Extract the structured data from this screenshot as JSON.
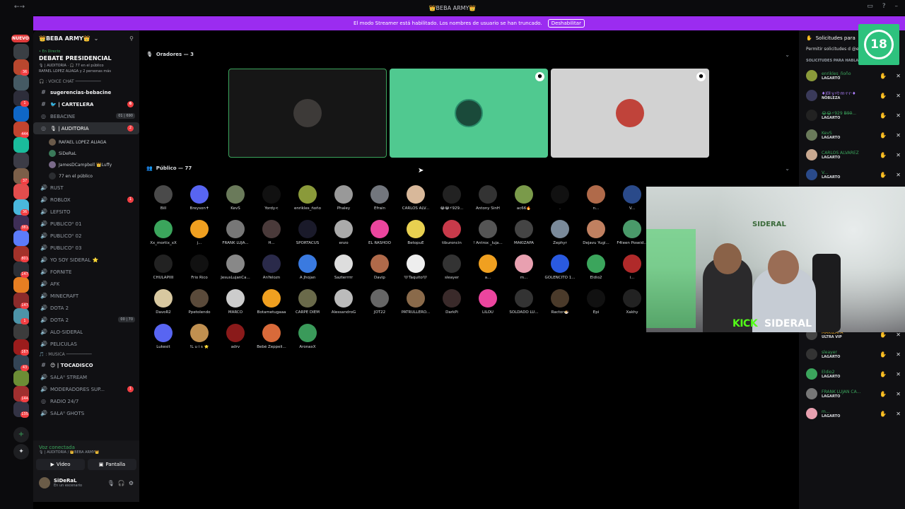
{
  "window": {
    "title": "👑BEBA ARMY👑",
    "nav_label": "←→"
  },
  "banner": {
    "text": "El modo Streamer está habilitado. Los nombres de usuario se han truncado.",
    "button": "Deshabilitar"
  },
  "rail": {
    "new_label": "NUEVO",
    "badges": [
      "36",
      "1",
      "444",
      "37",
      "36",
      "381",
      "801",
      "147",
      "147",
      "1",
      "167",
      "43",
      "144",
      "135"
    ],
    "colors": [
      "#3a3f44",
      "#b8472e",
      "#455a64",
      "#2d2d3a",
      "#0f67c7",
      "#c1442f",
      "#1abc9c",
      "#3c3c46",
      "#7b5f49",
      "#e24d4d",
      "#4ab7dc",
      "#3e2e56",
      "#5c7cfa",
      "#a3322a",
      "#2b2f36",
      "#e67e22",
      "#8b2b2b",
      "#4d94a8",
      "#3c3c3c",
      "#9b1c1c",
      "#345",
      "#6c8d35",
      "#a02f2f",
      "#334"
    ]
  },
  "channels": {
    "server_name": "👑BEBA ARMY👑",
    "live_tag": "• En Directo",
    "event_title": "DEBATE PRESIDENCIAL",
    "event_line1": "🎙 | AUDITORIA · 🎧 77 en el público",
    "event_line2": "RAFAEL LOPEZ ALIAGA y 2 personas más",
    "cat_voice": "🎧 : VOICE CHAT ──────────",
    "items": [
      {
        "label": "sugerencias-bebacine",
        "icon": "#",
        "bold": true
      },
      {
        "label": "🐦 | CARTELERA",
        "icon": "#",
        "bold": true,
        "badge": "6"
      },
      {
        "label": "BEBACINE",
        "icon": "◎",
        "counts": "01 | 690"
      },
      {
        "label": "🎙 | AUDITORIA",
        "icon": "◎",
        "selected": true,
        "badge": "2"
      }
    ],
    "auditoria_sub": "DEBATE PRESIDENCIAL",
    "members": [
      "RAFAEL LOPEZ ALIAGA",
      "SiDeRaL",
      "JamesDCampbell 👑Luffy",
      "77 en el público"
    ],
    "items2": [
      {
        "label": "RUST",
        "icon": "🔊"
      },
      {
        "label": "ROBLOX",
        "icon": "🔊",
        "badge": "1"
      },
      {
        "label": "LEFSITO",
        "icon": "🔊"
      },
      {
        "label": "PUBLICO⁰ 01",
        "icon": "🔊"
      },
      {
        "label": "PUBLICO⁰ 02",
        "icon": "🔊"
      },
      {
        "label": "PUBLICO⁰ 03",
        "icon": "🔊"
      },
      {
        "label": "YO SOY SIDERAL ⭐",
        "icon": "🔊"
      },
      {
        "label": "FORNITE",
        "icon": "🔊"
      },
      {
        "label": "AFK",
        "icon": "🔊"
      },
      {
        "label": "MINECRAFT",
        "icon": "🔊"
      },
      {
        "label": "DOTA 2",
        "icon": "🔊"
      },
      {
        "label": "DOTA 2",
        "icon": "🔊",
        "counts": "00 | 70"
      },
      {
        "label": "ALO-SIDERAL",
        "icon": "🔊"
      },
      {
        "label": "PELICULAS",
        "icon": "🔊"
      }
    ],
    "cat_music": "🎵 : MUSICA ──────────",
    "items3": [
      {
        "label": "😊 | TOCADISCO",
        "icon": "#",
        "bold": true
      },
      {
        "label": "SALA⁰ STREAM",
        "icon": "🔊"
      },
      {
        "label": "MODERADORES SUP...",
        "icon": "🔊",
        "badge": "1"
      },
      {
        "label": "RADIO 24/7",
        "icon": "◎"
      },
      {
        "label": "SALA⁰ GHOTS",
        "icon": "🔊"
      }
    ]
  },
  "voice": {
    "status": "Voz conectada",
    "sub": "🎙 | AUDITORIA / 👑BEBA ARMY👑",
    "video": "Video",
    "screen": "Pantalla"
  },
  "user": {
    "name": "SiDeRaL",
    "status": "En un escenario"
  },
  "stage": {
    "speakers_header": "Oradores — 3",
    "audience_header": "Público — 77",
    "audience": [
      {
        "name": "Bill",
        "color": "#4a4a4a"
      },
      {
        "name": "Breyson✝",
        "color": "#5865f2"
      },
      {
        "name": "KevS",
        "color": "#6a7a5a"
      },
      {
        "name": "Yordy<",
        "color": "#111"
      },
      {
        "name": "enrikles_ñoño",
        "color": "#8a9a3a"
      },
      {
        "name": "Phaley",
        "color": "#999"
      },
      {
        "name": "Efrain",
        "color": "#72767d"
      },
      {
        "name": "CARLOS ALV...",
        "color": "#d8b89a"
      },
      {
        "name": "😂😂⚡929...",
        "color": "#222"
      },
      {
        "name": "Antony SinH",
        "color": "#333"
      },
      {
        "name": "ac66🔥",
        "color": "#7a9a4a"
      },
      {
        "name": ".",
        "color": "#111"
      },
      {
        "name": "n...",
        "color": "#b06a4a"
      },
      {
        "name": "V...",
        "color": "#2a4a8a"
      },
      {
        "name": "Xx_mortix_xX",
        "color": "#3ba55c"
      },
      {
        "name": "j...",
        "color": "#f0a020"
      },
      {
        "name": "FRANK LUJA...",
        "color": "#777"
      },
      {
        "name": "H...",
        "color": "#4a3a3a"
      },
      {
        "name": "SPORTACUS",
        "color": "#1a1a2a"
      },
      {
        "name": "enzo",
        "color": "#aaa"
      },
      {
        "name": "EL RASHOO",
        "color": "#eb459e"
      },
      {
        "name": "BetopuE",
        "color": "#e8d050"
      },
      {
        "name": "tiburoncin",
        "color": "#c83a4a"
      },
      {
        "name": "! Antrox _luja...",
        "color": "#555"
      },
      {
        "name": "MAKIZAPA",
        "color": "#444"
      },
      {
        "name": "Zephyr",
        "color": "#7a8a9a"
      },
      {
        "name": "Dejavu Yugi...",
        "color": "#c08060"
      },
      {
        "name": "F4leen Poseid...",
        "color": "#4a9a6a"
      },
      {
        "name": "CHULAPIIII",
        "color": "#222"
      },
      {
        "name": "Frio Rico",
        "color": "#111"
      },
      {
        "name": "JesusLujanCa...",
        "color": "#888"
      },
      {
        "name": "AnYelozn",
        "color": "#2a2a4a"
      },
      {
        "name": "A Jhojan",
        "color": "#3a7ae0"
      },
      {
        "name": "Sazterrrrr",
        "color": "#ddd"
      },
      {
        "name": "Davip",
        "color": "#b06a4a"
      },
      {
        "name": "🖤Taquito🖤",
        "color": "#eee"
      },
      {
        "name": "sleayer",
        "color": "#333"
      },
      {
        "name": "a...",
        "color": "#f0a020"
      },
      {
        "name": "m...",
        "color": "#e8a0b0"
      },
      {
        "name": "GOLENCITO 1...",
        "color": "#2a5ae0"
      },
      {
        "name": "Eldio2",
        "color": "#3ba55c"
      },
      {
        "name": "i...",
        "color": "#b02a2a"
      },
      {
        "name": "DavoR2",
        "color": "#d8c8a0"
      },
      {
        "name": "Ppetolendo",
        "color": "#5a4a3a"
      },
      {
        "name": "MARCO",
        "color": "#ccc"
      },
      {
        "name": "Botametugaaa",
        "color": "#f0a020"
      },
      {
        "name": "CARPE DIEM",
        "color": "#6a6a4a"
      },
      {
        "name": "AlessandroG",
        "color": "#bbb"
      },
      {
        "name": "JOT22",
        "color": "#666"
      },
      {
        "name": "PATRULLERO...",
        "color": "#8a6a4a"
      },
      {
        "name": "DarkPi",
        "color": "#3a2a2a"
      },
      {
        "name": "LILOU",
        "color": "#eb459e"
      },
      {
        "name": "SOLDADO LU...",
        "color": "#333"
      },
      {
        "name": "Ractor🍜",
        "color": "#4a3a2a"
      },
      {
        "name": "Epi",
        "color": "#111"
      },
      {
        "name": "Xakhy",
        "color": "#222"
      },
      {
        "name": "Lukesit",
        "color": "#5865f2"
      },
      {
        "name": "!L u i s ⭐",
        "color": "#c09050"
      },
      {
        "name": "adrv",
        "color": "#8a1a1a"
      },
      {
        "name": "Bebé Zeppeli...",
        "color": "#d86a3a"
      },
      {
        "name": "AronaxX",
        "color": "#3a9a5a"
      }
    ]
  },
  "requests": {
    "title": "Solicitudes para",
    "perm": "Permitir solicitudes d @everyone",
    "label": "SOLICITUDES PARA HABLAR: 19",
    "items": [
      {
        "name": "enrikles_ñoño",
        "role": "LAGARTO",
        "color": "#3ba55c"
      },
      {
        "name": "♦J0l·y⚡t·m·r·r·♦",
        "role": "NOBLEZA",
        "color": "#b080ff"
      },
      {
        "name": "😂😂⚡929 B̶9̶0̶...",
        "role": "LAGARTO",
        "color": "#3ba55c"
      },
      {
        "name": "KevS",
        "role": "LAGARTO",
        "color": "#3ba55c"
      },
      {
        "name": "CARLOS ALVAREZ",
        "role": "LAGARTO",
        "color": "#3ba55c"
      },
      {
        "name": "V...",
        "role": "LAGARTO",
        "color": "#3ba55c"
      },
      {
        "name": "n...",
        "role": "LAGARTO",
        "color": "#3ba55c"
      },
      {
        "name": "MAKIZAPA",
        "role": "ULTRA VIP",
        "color": "#e0a020"
      },
      {
        "name": "sleayer",
        "role": "LAGARTO",
        "color": "#3ba55c"
      },
      {
        "name": "Eldio2",
        "role": "LAGARTO",
        "color": "#3ba55c"
      },
      {
        "name": "FRANK LUJAN CA...",
        "role": "LAGARTO",
        "color": "#3ba55c"
      },
      {
        "name": "m...",
        "role": "LAGARTO",
        "color": "#3ba55c"
      }
    ]
  },
  "overlay": {
    "age": "18",
    "wall_text": "SIDERAL",
    "kick": "KICK",
    "name": "SIDERAL"
  }
}
